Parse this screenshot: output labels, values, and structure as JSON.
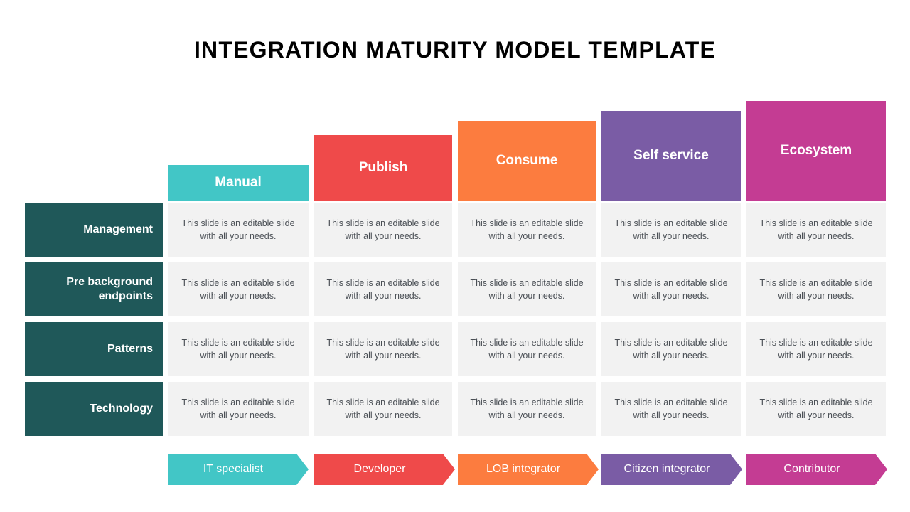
{
  "title": "INTEGRATION MATURITY MODEL TEMPLATE",
  "colors": {
    "teal": "#42C6C6",
    "red": "#EF4A4A",
    "orange": "#FC7C3F",
    "purple": "#7A5CA5",
    "magenta": "#C43C93",
    "dark_teal": "#1F5859",
    "cell_bg": "#F2F2F2",
    "cell_text": "#4a4f55",
    "page_bg": "#FFFFFF"
  },
  "columns": [
    {
      "label": "Manual",
      "color": "#42C6C6",
      "role": "IT specialist"
    },
    {
      "label": "Publish",
      "color": "#EF4A4A",
      "role": "Developer"
    },
    {
      "label": "Consume",
      "color": "#FC7C3F",
      "role": "LOB integrator"
    },
    {
      "label": "Self service",
      "color": "#7A5CA5",
      "role": "Citizen integrator"
    },
    {
      "label": "Ecosystem",
      "color": "#C43C93",
      "role": "Contributor"
    }
  ],
  "rows": [
    {
      "label": "Management"
    },
    {
      "label": "Pre background endpoints"
    },
    {
      "label": "Patterns"
    },
    {
      "label": "Technology"
    }
  ],
  "cell_text": "This slide is an editable slide with all your needs.",
  "cells": [
    [
      "This slide is an editable slide with all your needs.",
      "This slide is an editable slide with all your needs.",
      "This slide is an editable slide with all your needs.",
      "This slide is an editable slide with all your needs.",
      "This slide is an editable slide with all your needs."
    ],
    [
      "This slide is an editable slide with all your needs.",
      "This slide is an editable slide with all your needs.",
      "This slide is an editable slide with all your needs.",
      "This slide is an editable slide with all your needs.",
      "This slide is an editable slide with all your needs."
    ],
    [
      "This slide is an editable slide with all your needs.",
      "This slide is an editable slide with all your needs.",
      "This slide is an editable slide with all your needs.",
      "This slide is an editable slide with all your needs.",
      "This slide is an editable slide with all your needs."
    ],
    [
      "This slide is an editable slide with all your needs.",
      "This slide is an editable slide with all your needs.",
      "This slide is an editable slide with all your needs.",
      "This slide is an editable slide with all your needs.",
      "This slide is an editable slide with all your needs."
    ]
  ]
}
